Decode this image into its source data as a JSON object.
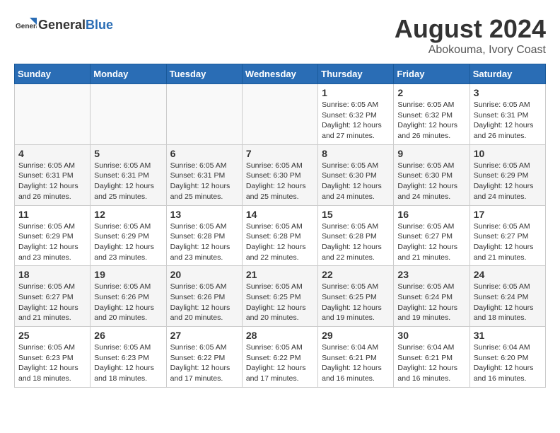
{
  "header": {
    "logo_general": "General",
    "logo_blue": "Blue",
    "month_year": "August 2024",
    "location": "Abokouma, Ivory Coast"
  },
  "weekdays": [
    "Sunday",
    "Monday",
    "Tuesday",
    "Wednesday",
    "Thursday",
    "Friday",
    "Saturday"
  ],
  "weeks": [
    [
      {
        "day": "",
        "info": ""
      },
      {
        "day": "",
        "info": ""
      },
      {
        "day": "",
        "info": ""
      },
      {
        "day": "",
        "info": ""
      },
      {
        "day": "1",
        "info": "Sunrise: 6:05 AM\nSunset: 6:32 PM\nDaylight: 12 hours\nand 27 minutes."
      },
      {
        "day": "2",
        "info": "Sunrise: 6:05 AM\nSunset: 6:32 PM\nDaylight: 12 hours\nand 26 minutes."
      },
      {
        "day": "3",
        "info": "Sunrise: 6:05 AM\nSunset: 6:31 PM\nDaylight: 12 hours\nand 26 minutes."
      }
    ],
    [
      {
        "day": "4",
        "info": "Sunrise: 6:05 AM\nSunset: 6:31 PM\nDaylight: 12 hours\nand 26 minutes."
      },
      {
        "day": "5",
        "info": "Sunrise: 6:05 AM\nSunset: 6:31 PM\nDaylight: 12 hours\nand 25 minutes."
      },
      {
        "day": "6",
        "info": "Sunrise: 6:05 AM\nSunset: 6:31 PM\nDaylight: 12 hours\nand 25 minutes."
      },
      {
        "day": "7",
        "info": "Sunrise: 6:05 AM\nSunset: 6:30 PM\nDaylight: 12 hours\nand 25 minutes."
      },
      {
        "day": "8",
        "info": "Sunrise: 6:05 AM\nSunset: 6:30 PM\nDaylight: 12 hours\nand 24 minutes."
      },
      {
        "day": "9",
        "info": "Sunrise: 6:05 AM\nSunset: 6:30 PM\nDaylight: 12 hours\nand 24 minutes."
      },
      {
        "day": "10",
        "info": "Sunrise: 6:05 AM\nSunset: 6:29 PM\nDaylight: 12 hours\nand 24 minutes."
      }
    ],
    [
      {
        "day": "11",
        "info": "Sunrise: 6:05 AM\nSunset: 6:29 PM\nDaylight: 12 hours\nand 23 minutes."
      },
      {
        "day": "12",
        "info": "Sunrise: 6:05 AM\nSunset: 6:29 PM\nDaylight: 12 hours\nand 23 minutes."
      },
      {
        "day": "13",
        "info": "Sunrise: 6:05 AM\nSunset: 6:28 PM\nDaylight: 12 hours\nand 23 minutes."
      },
      {
        "day": "14",
        "info": "Sunrise: 6:05 AM\nSunset: 6:28 PM\nDaylight: 12 hours\nand 22 minutes."
      },
      {
        "day": "15",
        "info": "Sunrise: 6:05 AM\nSunset: 6:28 PM\nDaylight: 12 hours\nand 22 minutes."
      },
      {
        "day": "16",
        "info": "Sunrise: 6:05 AM\nSunset: 6:27 PM\nDaylight: 12 hours\nand 21 minutes."
      },
      {
        "day": "17",
        "info": "Sunrise: 6:05 AM\nSunset: 6:27 PM\nDaylight: 12 hours\nand 21 minutes."
      }
    ],
    [
      {
        "day": "18",
        "info": "Sunrise: 6:05 AM\nSunset: 6:27 PM\nDaylight: 12 hours\nand 21 minutes."
      },
      {
        "day": "19",
        "info": "Sunrise: 6:05 AM\nSunset: 6:26 PM\nDaylight: 12 hours\nand 20 minutes."
      },
      {
        "day": "20",
        "info": "Sunrise: 6:05 AM\nSunset: 6:26 PM\nDaylight: 12 hours\nand 20 minutes."
      },
      {
        "day": "21",
        "info": "Sunrise: 6:05 AM\nSunset: 6:25 PM\nDaylight: 12 hours\nand 20 minutes."
      },
      {
        "day": "22",
        "info": "Sunrise: 6:05 AM\nSunset: 6:25 PM\nDaylight: 12 hours\nand 19 minutes."
      },
      {
        "day": "23",
        "info": "Sunrise: 6:05 AM\nSunset: 6:24 PM\nDaylight: 12 hours\nand 19 minutes."
      },
      {
        "day": "24",
        "info": "Sunrise: 6:05 AM\nSunset: 6:24 PM\nDaylight: 12 hours\nand 18 minutes."
      }
    ],
    [
      {
        "day": "25",
        "info": "Sunrise: 6:05 AM\nSunset: 6:23 PM\nDaylight: 12 hours\nand 18 minutes."
      },
      {
        "day": "26",
        "info": "Sunrise: 6:05 AM\nSunset: 6:23 PM\nDaylight: 12 hours\nand 18 minutes."
      },
      {
        "day": "27",
        "info": "Sunrise: 6:05 AM\nSunset: 6:22 PM\nDaylight: 12 hours\nand 17 minutes."
      },
      {
        "day": "28",
        "info": "Sunrise: 6:05 AM\nSunset: 6:22 PM\nDaylight: 12 hours\nand 17 minutes."
      },
      {
        "day": "29",
        "info": "Sunrise: 6:04 AM\nSunset: 6:21 PM\nDaylight: 12 hours\nand 16 minutes."
      },
      {
        "day": "30",
        "info": "Sunrise: 6:04 AM\nSunset: 6:21 PM\nDaylight: 12 hours\nand 16 minutes."
      },
      {
        "day": "31",
        "info": "Sunrise: 6:04 AM\nSunset: 6:20 PM\nDaylight: 12 hours\nand 16 minutes."
      }
    ]
  ]
}
